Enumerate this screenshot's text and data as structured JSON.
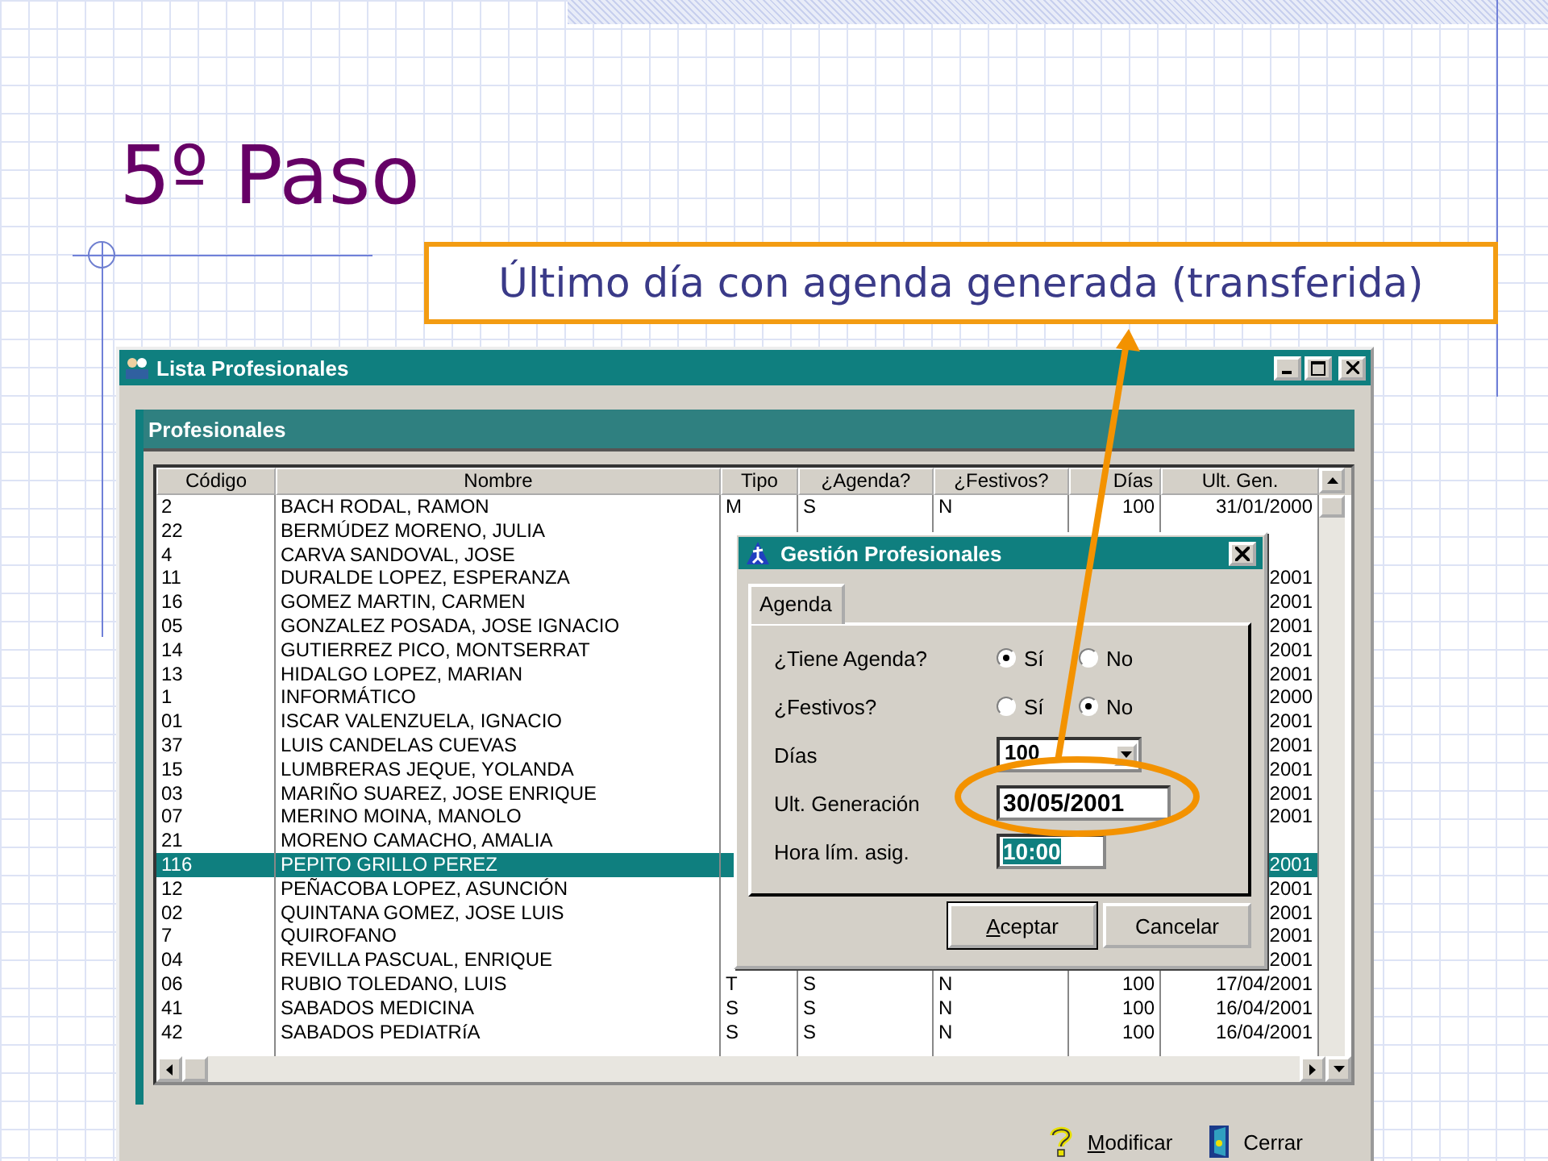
{
  "slide": {
    "title": "5º Paso",
    "callout": "Último día con agenda generada (transferida)"
  },
  "window": {
    "title": "Lista Profesionales",
    "panel_title": "Profesionales",
    "table": {
      "columns": [
        {
          "label": "Código"
        },
        {
          "label": "Nombre"
        },
        {
          "label": "Tipo"
        },
        {
          "label": "¿Agenda?"
        },
        {
          "label": "¿Festivos?"
        },
        {
          "label": "Días"
        },
        {
          "label": "Ult. Gen."
        }
      ],
      "rows": [
        {
          "codigo": "2",
          "nombre": "BACH RODAL, RAMON",
          "tipo": "M",
          "agenda": "S",
          "festivos": "N",
          "dias": "100",
          "ult_gen": "31/01/2000",
          "selected": false
        },
        {
          "codigo": "22",
          "nombre": "BERMÚDEZ MORENO, JULIA",
          "selected": false
        },
        {
          "codigo": "4",
          "nombre": "CARVA SANDOVAL, JOSE",
          "selected": false
        },
        {
          "codigo": "11",
          "nombre": "DURALDE LOPEZ, ESPERANZA",
          "ult_gen": "2001",
          "selected": false
        },
        {
          "codigo": "16",
          "nombre": "GOMEZ MARTIN, CARMEN",
          "ult_gen": "2001",
          "selected": false
        },
        {
          "codigo": "05",
          "nombre": "GONZALEZ POSADA, JOSE IGNACIO",
          "ult_gen": "2001",
          "selected": false
        },
        {
          "codigo": "14",
          "nombre": "GUTIERREZ PICO, MONTSERRAT",
          "ult_gen": "2001",
          "selected": false
        },
        {
          "codigo": "13",
          "nombre": "HIDALGO LOPEZ, MARIAN",
          "ult_gen": "2001",
          "selected": false
        },
        {
          "codigo": "1",
          "nombre": "INFORMÁTICO",
          "ult_gen": "2000",
          "selected": false
        },
        {
          "codigo": "01",
          "nombre": "ISCAR VALENZUELA, IGNACIO",
          "ult_gen": "2001",
          "selected": false
        },
        {
          "codigo": "37",
          "nombre": "LUIS CANDELAS CUEVAS",
          "ult_gen": "2001",
          "selected": false
        },
        {
          "codigo": "15",
          "nombre": "LUMBRERAS JEQUE, YOLANDA",
          "ult_gen": "2001",
          "selected": false
        },
        {
          "codigo": "03",
          "nombre": "MARIÑO SUAREZ, JOSE ENRIQUE",
          "ult_gen": "2001",
          "selected": false
        },
        {
          "codigo": "07",
          "nombre": "MERINO MOINA, MANOLO",
          "ult_gen": "2001",
          "selected": false
        },
        {
          "codigo": "21",
          "nombre": "MORENO CAMACHO, AMALIA",
          "selected": false
        },
        {
          "codigo": "116",
          "nombre": "PEPITO GRILLO PEREZ",
          "ult_gen": "2001",
          "selected": true
        },
        {
          "codigo": "12",
          "nombre": "PEÑACOBA LOPEZ, ASUNCIÓN",
          "ult_gen": "2001",
          "selected": false
        },
        {
          "codigo": "02",
          "nombre": "QUINTANA GOMEZ, JOSE LUIS",
          "ult_gen": "2001",
          "selected": false
        },
        {
          "codigo": "7",
          "nombre": "QUIROFANO",
          "ult_gen": "2001",
          "selected": false
        },
        {
          "codigo": "04",
          "nombre": "REVILLA PASCUAL, ENRIQUE",
          "ult_gen": "2001",
          "selected": false
        },
        {
          "codigo": "06",
          "nombre": "RUBIO TOLEDANO, LUIS",
          "tipo": "T",
          "agenda": "S",
          "festivos": "N",
          "dias": "100",
          "ult_gen": "17/04/2001",
          "selected": false
        },
        {
          "codigo": "41",
          "nombre": "SABADOS MEDICINA",
          "tipo": "S",
          "agenda": "S",
          "festivos": "N",
          "dias": "100",
          "ult_gen": "16/04/2001",
          "selected": false
        },
        {
          "codigo": "42",
          "nombre": "SABADOS PEDIATRíA",
          "tipo": "S",
          "agenda": "S",
          "festivos": "N",
          "dias": "100",
          "ult_gen": "16/04/2001",
          "selected": false
        }
      ]
    },
    "buttons": [
      {
        "label": "Modificar",
        "kind": "help",
        "underline_first": true
      },
      {
        "label": "Cerrar",
        "kind": "exit",
        "underline_first": false
      }
    ]
  },
  "dialog": {
    "title": "Gestión Profesionales",
    "tabs": [
      {
        "label": "Agenda",
        "selected": true
      }
    ],
    "fields": [
      {
        "kind": "radio",
        "label": "¿Tiene Agenda?",
        "options": [
          {
            "label": "Sí",
            "selected": true
          },
          {
            "label": "No",
            "selected": false
          }
        ]
      },
      {
        "kind": "radio",
        "label": "¿Festivos?",
        "options": [
          {
            "label": "Sí",
            "selected": false
          },
          {
            "label": "No",
            "selected": true
          }
        ]
      },
      {
        "kind": "combo",
        "label": "Días",
        "value": "100"
      },
      {
        "kind": "text",
        "label": "Ult. Generación",
        "value": "30/05/2001",
        "highlighted": false
      },
      {
        "kind": "text",
        "label": "Hora lím. asig.",
        "value": "10:00",
        "highlighted": true
      }
    ],
    "buttons": [
      {
        "label": "Aceptar",
        "default": true,
        "underline_first": true
      },
      {
        "label": "Cancelar",
        "default": false,
        "underline_first": false
      }
    ]
  }
}
